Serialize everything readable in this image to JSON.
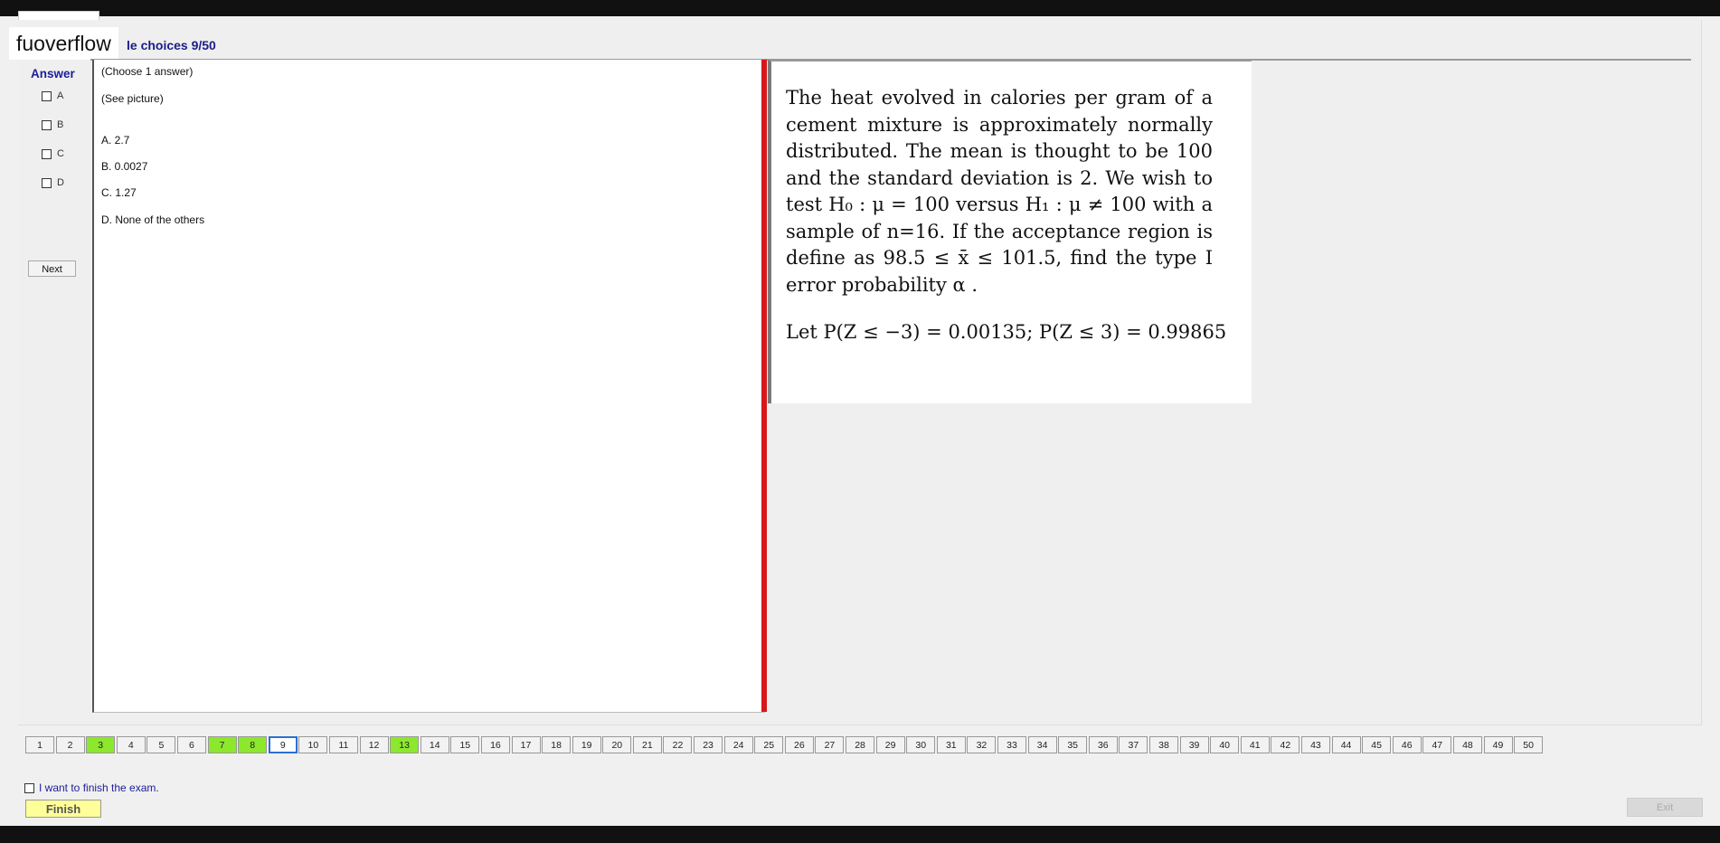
{
  "watermark": "fuoverflow",
  "section_title": "le choices 9/50",
  "answer_panel": {
    "label": "Answer",
    "options": [
      "A",
      "B",
      "C",
      "D"
    ],
    "next_label": "Next"
  },
  "question": {
    "instruction": "(Choose 1 answer)",
    "see_picture": "(See picture)",
    "choices": [
      "A.  2.7",
      "B.  0.0027",
      "C.  1.27",
      "D.  None of the others"
    ]
  },
  "picture": {
    "text": "The heat evolved in calories per gram of a cement mixture is approximately normally distributed. The mean is thought to be 100 and the standard deviation is 2. We wish to test H₀ : μ = 100 versus H₁ : μ ≠ 100 with a sample of n=16. If the acceptance region is define as 98.5 ≤ x̄ ≤ 101.5, find the type I error probability α .",
    "formula": "Let P(Z ≤ −3) = 0.00135; P(Z ≤ 3) = 0.99865"
  },
  "navigation": {
    "pages": [
      "1",
      "2",
      "3",
      "4",
      "5",
      "6",
      "7",
      "8",
      "9",
      "10",
      "11",
      "12",
      "13",
      "14",
      "15",
      "16",
      "17",
      "18",
      "19",
      "20",
      "21",
      "22",
      "23",
      "24",
      "25",
      "26",
      "27",
      "28",
      "29",
      "30",
      "31",
      "32",
      "33",
      "34",
      "35",
      "36",
      "37",
      "38",
      "39",
      "40",
      "41",
      "42",
      "43",
      "44",
      "45",
      "46",
      "47",
      "48",
      "49",
      "50"
    ],
    "answered": [
      "3",
      "7",
      "8",
      "13"
    ],
    "current": "9"
  },
  "footer": {
    "finish_checkbox_label": "I want to finish the exam.",
    "finish_label": "Finish",
    "exit_label": "Exit"
  }
}
